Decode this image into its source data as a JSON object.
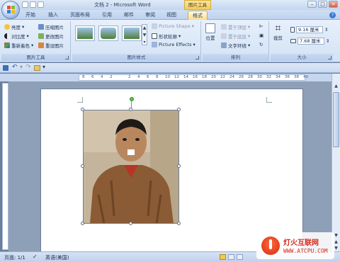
{
  "window": {
    "title": "文档 2 - Microsoft Word",
    "context_tab_header": "图片工具"
  },
  "tabs": [
    "开始",
    "插入",
    "页面布局",
    "引用",
    "邮件",
    "审阅",
    "视图",
    "格式"
  ],
  "ribbon": {
    "adjust": {
      "label": "图片工具",
      "brightness": "亮度",
      "contrast": "对比度",
      "recolor": "重新着色",
      "compress": "压缩图片",
      "change": "更改图片",
      "reset": "重设图片"
    },
    "styles": {
      "label": "图片样式",
      "shape": "Picture Shape",
      "border": "形状轮廓",
      "effects": "Picture Effects"
    },
    "arrange": {
      "label": "排列",
      "position": "位置",
      "front": "置于顶层",
      "back": "置于底层",
      "wrap": "文字环绕"
    },
    "size": {
      "label": "大小",
      "crop": "裁剪",
      "height": "9.16 厘米",
      "width": "7.68 厘米"
    }
  },
  "ruler": {
    "ticks": [
      "8",
      "6",
      "4",
      "2",
      "",
      "2",
      "4",
      "6",
      "8",
      "10",
      "12",
      "14",
      "16",
      "18",
      "20",
      "22",
      "24",
      "26",
      "28",
      "30",
      "32",
      "34",
      "36",
      "38",
      "40"
    ]
  },
  "status": {
    "page": "页面: 1/1",
    "language": "英语(美国)"
  },
  "watermark": {
    "name": "灯火互联网",
    "url": "WWW.ATCPU.COM"
  },
  "colors": {
    "ribbon": "#d3e2f5",
    "context_tab": "#f2cc5c",
    "brand_red": "#d62a1a"
  }
}
